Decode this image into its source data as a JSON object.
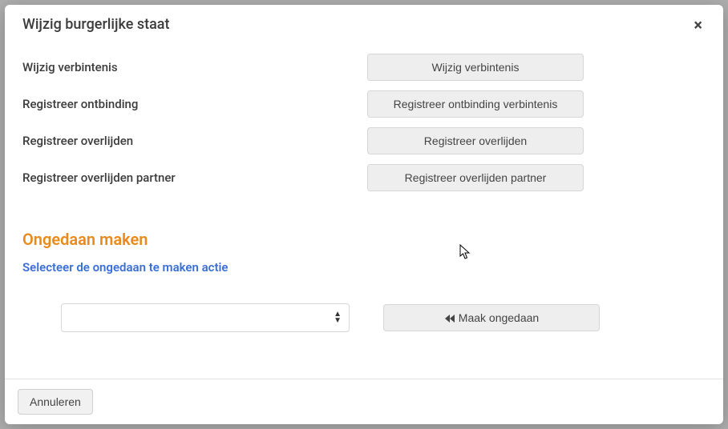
{
  "modal": {
    "title": "Wijzig burgerlijke staat",
    "close_label": "×"
  },
  "actions": [
    {
      "label": "Wijzig verbintenis",
      "button": "Wijzig verbintenis"
    },
    {
      "label": "Registreer ontbinding",
      "button": "Registreer ontbinding verbintenis"
    },
    {
      "label": "Registreer overlijden",
      "button": "Registreer overlijden"
    },
    {
      "label": "Registreer overlijden partner",
      "button": "Registreer overlijden partner"
    }
  ],
  "undo": {
    "heading": "Ongedaan maken",
    "subheading": "Selecteer de ongedaan te maken actie",
    "select_value": "",
    "button": "Maak ongedaan"
  },
  "footer": {
    "cancel": "Annuleren"
  }
}
